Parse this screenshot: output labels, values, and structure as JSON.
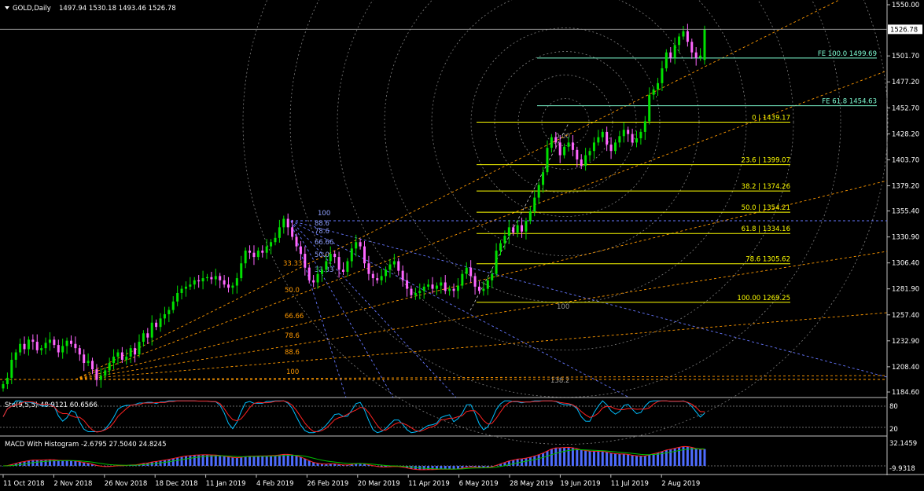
{
  "header": {
    "symbol_text": "GOLD,Daily",
    "ohlc_text": "1497.94 1530.18 1493.46 1526.78"
  },
  "colors": {
    "background": "#000000",
    "bull": "#00e000",
    "bear": "#ff66ff",
    "fib_line": "#ffff00",
    "fib_text": "#ffff00",
    "fe_line": "#7fffd4",
    "fe_text": "#7fffd4",
    "fan_orange": "#ff9900",
    "fan_blue": "#6677ff",
    "arc_gray": "#808080",
    "stoch_main": "#00bfff",
    "stoch_signal": "#ff2222",
    "macd_hist": "#4e6cff",
    "macd_line": "#ff2222",
    "macd_signal": "#00c000"
  },
  "price_axis": {
    "ticks": [
      "1550.00",
      "1526.78",
      "1501.70",
      "1477.20",
      "1452.70",
      "1428.20",
      "1403.70",
      "1379.20",
      "1355.40",
      "1330.90",
      "1306.40",
      "1281.90",
      "1257.40",
      "1232.90",
      "1208.40",
      "1184.60"
    ],
    "current_price": "1526.78"
  },
  "time_axis": [
    "11 Oct 2018",
    "2 Nov 2018",
    "26 Nov 2018",
    "18 Dec 2018",
    "11 Jan 2019",
    "4 Feb 2019",
    "26 Feb 2019",
    "20 Mar 2019",
    "11 Apr 2019",
    "6 May 2019",
    "28 May 2019",
    "19 Jun 2019",
    "11 Jul 2019",
    "2 Aug 2019"
  ],
  "fib_retracement_labels": [
    {
      "text": "0   | 1439.17",
      "value": 1439.17
    },
    {
      "text": "23.6 | 1399.07",
      "value": 1399.07
    },
    {
      "text": "38.2 | 1374.26",
      "value": 1374.26
    },
    {
      "text": "50.0 | 1354.21",
      "value": 1354.21
    },
    {
      "text": "61.8 | 1334.16",
      "value": 1334.16
    },
    {
      "text": "78.6  1305.62",
      "value": 1305.62
    },
    {
      "text": "100.00  1269.25",
      "value": 1269.25
    }
  ],
  "fib_expansion_labels": [
    {
      "text": "FE 100.0  1499.69",
      "value": 1499.69
    },
    {
      "text": "FE 61.8 1454.63",
      "value": 1454.63
    }
  ],
  "fan_labels_orange": [
    "33.33",
    "50.0",
    "66.66",
    "78.6",
    "88.6",
    "100"
  ],
  "fan_labels_blue": [
    "100",
    "88.6",
    "78.6",
    "66.66",
    "50.0",
    "33.33"
  ],
  "arc_labels": [
    "0.00",
    "100",
    "138.2"
  ],
  "stoch": {
    "label": "Sto(9,5,5) 48.9121 60.6566",
    "levels": [
      "80",
      "20"
    ]
  },
  "macd": {
    "label": "MACD With Histogram -2.6795 27.5040 24.8245",
    "axis_top": "32.1459",
    "axis_bottom": "-9.9318"
  },
  "chart_data": {
    "type": "candlestick",
    "title": "GOLD,Daily",
    "ylim": [
      1184.6,
      1550.0
    ],
    "x_start": "11 Oct 2018",
    "x_end": "2 Aug 2019",
    "last_bar": {
      "open": 1497.94,
      "high": 1530.18,
      "low": 1493.46,
      "close": 1526.78
    },
    "closes": [
      1192,
      1198,
      1215,
      1222,
      1230,
      1225,
      1234,
      1232,
      1224,
      1226,
      1231,
      1234,
      1229,
      1222,
      1228,
      1233,
      1230,
      1226,
      1220,
      1212,
      1214,
      1206,
      1196,
      1200,
      1205,
      1212,
      1218,
      1222,
      1215,
      1218,
      1226,
      1220,
      1232,
      1240,
      1236,
      1250,
      1246,
      1254,
      1258,
      1262,
      1270,
      1278,
      1282,
      1284,
      1286,
      1290,
      1289,
      1292,
      1293,
      1291,
      1294,
      1290,
      1286,
      1283,
      1285,
      1292,
      1306,
      1318,
      1316,
      1312,
      1318,
      1316,
      1322,
      1326,
      1330,
      1340,
      1348,
      1340,
      1331,
      1322,
      1315,
      1302,
      1290,
      1288,
      1296,
      1300,
      1308,
      1315,
      1312,
      1300,
      1298,
      1308,
      1320,
      1326,
      1322,
      1306,
      1296,
      1292,
      1290,
      1294,
      1300,
      1305,
      1308,
      1299,
      1290,
      1282,
      1276,
      1278,
      1280,
      1284,
      1286,
      1282,
      1285,
      1288,
      1280,
      1282,
      1280,
      1285,
      1296,
      1302,
      1294,
      1284,
      1280,
      1282,
      1290,
      1296,
      1318,
      1325,
      1332,
      1340,
      1335,
      1342,
      1336,
      1346,
      1355,
      1368,
      1380,
      1392,
      1415,
      1425,
      1420,
      1408,
      1416,
      1420,
      1413,
      1404,
      1398,
      1408,
      1412,
      1420,
      1425,
      1430,
      1418,
      1412,
      1420,
      1426,
      1432,
      1428,
      1420,
      1424,
      1430,
      1440,
      1465,
      1470,
      1476,
      1490,
      1505,
      1500,
      1512,
      1520,
      1525,
      1515,
      1505,
      1500,
      1502,
      1526.78
    ]
  }
}
